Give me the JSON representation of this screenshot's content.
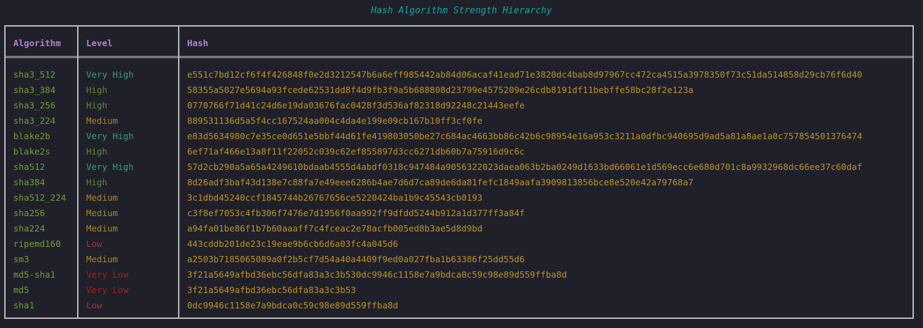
{
  "title": "Hash Algorithm Strength Hierarchy",
  "colors": {
    "background": "#1f2029",
    "border": "#b9b9b9",
    "header_text": "#b77fd3",
    "title_text": "#1aa3a3",
    "algorithm_text": "#6f9e38",
    "hash_text": "#c09125",
    "level_very_high": "#3a9e78",
    "level_high": "#5c8a2e",
    "level_medium": "#a8862a",
    "level_low": "#a8332e",
    "level_very_low": "#a4201e"
  },
  "headers": {
    "algorithm": "Algorithm",
    "level": "Level",
    "hash": "Hash"
  },
  "rows": [
    {
      "algorithm": "sha3_512",
      "level": "Very High",
      "hash": "e551c7bd12cf6f4f426848f0e2d3212547b6a6eff985442ab84d06acaf41ead71e3820dc4bab8d97967cc472ca4515a3978350f73c51da514858d29cb76f6d40"
    },
    {
      "algorithm": "sha3_384",
      "level": "High",
      "hash": "58355a5027e5694a93fcede62531dd8f4d9fb3f9a5b688808d23799e4575209e26cdb8191df11bebffe58bc28f2e123a"
    },
    {
      "algorithm": "sha3_256",
      "level": "High",
      "hash": "0770766f71d41c24d6e19da03676fac0428f3d536af82318d92248c21443eefe"
    },
    {
      "algorithm": "sha3_224",
      "level": "Medium",
      "hash": "889531136d5a5f4cc167524aa004c4da4e199e09cb167b10ff3cf0fe"
    },
    {
      "algorithm": "blake2b",
      "level": "Very High",
      "hash": "e83d5634980c7e35ce0d651e5bbf44d61fe419803050be27c684ac4663bb86c42b6c98954e16a953c3211a0dfbc940695d9ad5a81a8ae1a0c757854501376474"
    },
    {
      "algorithm": "blake2s",
      "level": "High",
      "hash": "6ef71af466e13a8f11f22052c039c62ef855897d3cc6271db60b7a75916d9c6c"
    },
    {
      "algorithm": "sha512",
      "level": "Very High",
      "hash": "57d2cb290a5a65a4249610bdaab4555d4abdf0318c947484a9056322023daea063b2ba0249d1633bd66061e1d569ecc6e680d701c8a9932968dc66ee37c60daf"
    },
    {
      "algorithm": "sha384",
      "level": "High",
      "hash": "8d26adf3baf43d138e7c88fa7e49eee6286b4ae7d6d7ca89de6da81fefc1849aafa3909813856bce8e520e42a79768a7"
    },
    {
      "algorithm": "sha512_224",
      "level": "Medium",
      "hash": "3c1dbd45240ccf1845744b26767656ce5220424ba1b9c45543cb0193"
    },
    {
      "algorithm": "sha256",
      "level": "Medium",
      "hash": "c3f8ef7053c4fb306f7476e7d1956f0aa992ff9dfdd5244b912a1d377ff3a84f"
    },
    {
      "algorithm": "sha224",
      "level": "Medium",
      "hash": "a94fa01be86f1b7b60aaaff7c4fceac2e78acfb005ed8b3ae5d8d9bd"
    },
    {
      "algorithm": "ripemd160",
      "level": "Low",
      "hash": "443cddb201de23c19eae9b6cb6d6a03fc4a045d6"
    },
    {
      "algorithm": "sm3",
      "level": "Medium",
      "hash": "a2503b7185065089a0f2b5cf7d54a40a4409f9ed0a027fba1b63386f25dd55d6"
    },
    {
      "algorithm": "md5-sha1",
      "level": "Very Low",
      "hash": "3f21a5649afbd36ebc56dfa83a3c3b530dc9946c1158e7a9bdca0c59c98e89d559ffba8d"
    },
    {
      "algorithm": "md5",
      "level": "Very Low",
      "hash": "3f21a5649afbd36ebc56dfa83a3c3b53"
    },
    {
      "algorithm": "sha1",
      "level": "Low",
      "hash": "0dc9946c1158e7a9bdca0c59c98e89d559ffba8d"
    }
  ]
}
